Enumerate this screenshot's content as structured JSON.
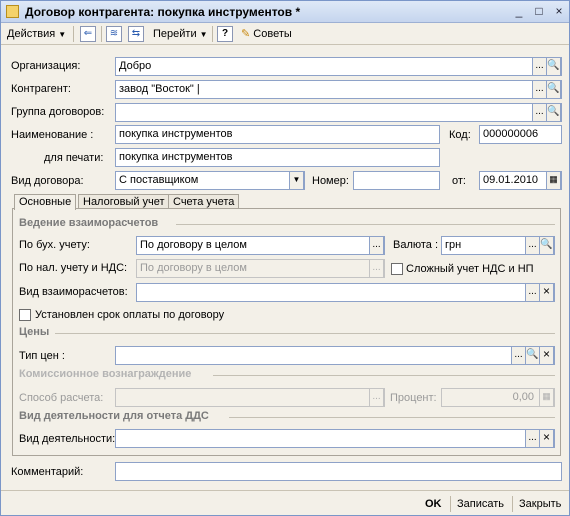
{
  "window": {
    "title": "Договор контрагента: покупка инструментов *",
    "controls": [
      "_",
      "□",
      "×"
    ]
  },
  "toolbar": {
    "actions_label": "Действия",
    "goto_label": "Перейти",
    "help_label": "?",
    "tips_label": "Советы"
  },
  "form": {
    "organization": {
      "label": "Организация:",
      "value": "Добро"
    },
    "counterparty": {
      "label": "Контрагент:",
      "value": "завод \"Восток\" |"
    },
    "contract_group": {
      "label": "Группа договоров:",
      "value": ""
    },
    "name": {
      "label": "Наименование :",
      "value": "покупка инструментов"
    },
    "code": {
      "label": "Код:",
      "value": "000000006"
    },
    "print_name": {
      "label": "для печати:",
      "value": "покупка инструментов"
    },
    "contract_type": {
      "label": "Вид договора:",
      "value": "С поставщиком"
    },
    "number": {
      "label": "Номер:",
      "value": ""
    },
    "date": {
      "label": "от:",
      "value": "09.01.2010"
    }
  },
  "tabs": [
    {
      "label": "Основные",
      "active": true
    },
    {
      "label": "Налоговый учет",
      "active": false
    },
    {
      "label": "Счета учета",
      "active": false
    }
  ],
  "settlements": {
    "title": "Ведение взаиморасчетов",
    "accounting": {
      "label": "По бух. учету:",
      "value": "По договору в целом"
    },
    "currency": {
      "label": "Валюта :",
      "value": "грн"
    },
    "tax_vat": {
      "label": "По нал. учету и НДС:",
      "value": "По договору в целом"
    },
    "complex_vat": {
      "label": "Сложный  учет НДС и НП",
      "checked": false
    },
    "settlement_type": {
      "label": "Вид взаиморасчетов:",
      "value": ""
    },
    "payment_term": {
      "label": "Установлен срок оплаты по договору",
      "checked": false
    }
  },
  "prices": {
    "title": "Цены",
    "price_type": {
      "label": "Тип цен :",
      "value": ""
    }
  },
  "commission": {
    "title": "Комиссионное вознаграждение",
    "method": {
      "label": "Способ расчета:",
      "value": ""
    },
    "percent": {
      "label": "Процент:",
      "value": "0,00"
    }
  },
  "activity": {
    "title": "Вид деятельности для отчета ДДС",
    "type": {
      "label": "Вид деятельности:",
      "value": ""
    }
  },
  "comment": {
    "label": "Комментарий:",
    "value": ""
  },
  "buttons": {
    "ok": "OK",
    "save": "Записать",
    "close": "Закрыть"
  },
  "glyphs": {
    "ellipsis": "...",
    "search": "🔍",
    "clear": "×",
    "dropdown": "▼",
    "calendar": "▦"
  }
}
